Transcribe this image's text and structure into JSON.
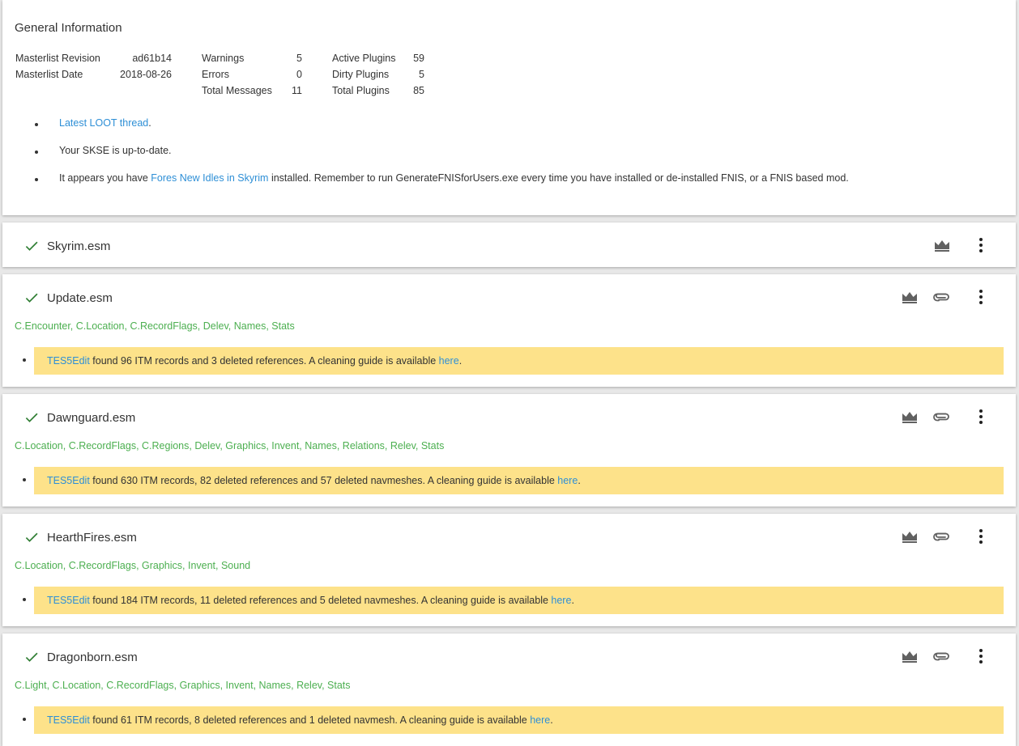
{
  "general": {
    "title": "General Information",
    "stats": {
      "masterlist_revision_label": "Masterlist Revision",
      "masterlist_revision": "ad61b14",
      "masterlist_date_label": "Masterlist Date",
      "masterlist_date": "2018-08-26",
      "warnings_label": "Warnings",
      "warnings": "5",
      "errors_label": "Errors",
      "errors": "0",
      "total_messages_label": "Total Messages",
      "total_messages": "11",
      "active_plugins_label": "Active Plugins",
      "active_plugins": "59",
      "dirty_plugins_label": "Dirty Plugins",
      "dirty_plugins": "5",
      "total_plugins_label": "Total Plugins",
      "total_plugins": "85"
    },
    "messages": [
      {
        "link": "Latest LOOT thread",
        "after": "."
      },
      {
        "text": "Your SKSE is up-to-date."
      },
      {
        "before": "It appears you have ",
        "link": "Fores New Idles in Skyrim",
        "after": " installed. Remember to run GenerateFNISforUsers.exe every time you have installed or de-installed FNIS, or a FNIS based mod."
      }
    ]
  },
  "plugins": [
    {
      "name": "Skyrim.esm"
    },
    {
      "name": "Update.esm",
      "tags": "C.Encounter, C.Location, C.RecordFlags, Delev, Names, Stats",
      "warn_link": "TES5Edit",
      "warn_text": " found 96 ITM records and 3 deleted references. A cleaning guide is available ",
      "warn_here": "here",
      "warn_end": "."
    },
    {
      "name": "Dawnguard.esm",
      "tags": "C.Location, C.RecordFlags, C.Regions, Delev, Graphics, Invent, Names, Relations, Relev, Stats",
      "warn_link": "TES5Edit",
      "warn_text": " found 630 ITM records, 82 deleted references and 57 deleted navmeshes. A cleaning guide is available ",
      "warn_here": "here",
      "warn_end": "."
    },
    {
      "name": "HearthFires.esm",
      "tags": "C.Location, C.RecordFlags, Graphics, Invent, Sound",
      "warn_link": "TES5Edit",
      "warn_text": " found 184 ITM records, 11 deleted references and 5 deleted navmeshes. A cleaning guide is available ",
      "warn_here": "here",
      "warn_end": "."
    },
    {
      "name": "Dragonborn.esm",
      "tags": "C.Light, C.Location, C.RecordFlags, Graphics, Invent, Names, Relev, Stats",
      "warn_link": "TES5Edit",
      "warn_text": " found 61 ITM records, 8 deleted references and 1 deleted navmesh. A cleaning guide is available ",
      "warn_here": "here",
      "warn_end": "."
    }
  ],
  "icons": {
    "check": "check-icon",
    "crown": "crown-icon",
    "attachment": "paperclip-icon",
    "menu": "more-vert-icon"
  },
  "colors": {
    "check": "#2e7d32",
    "tags": "#4caf50",
    "link": "#2e8fd6",
    "warning_bg": "#fde28a",
    "icon": "#616161"
  }
}
